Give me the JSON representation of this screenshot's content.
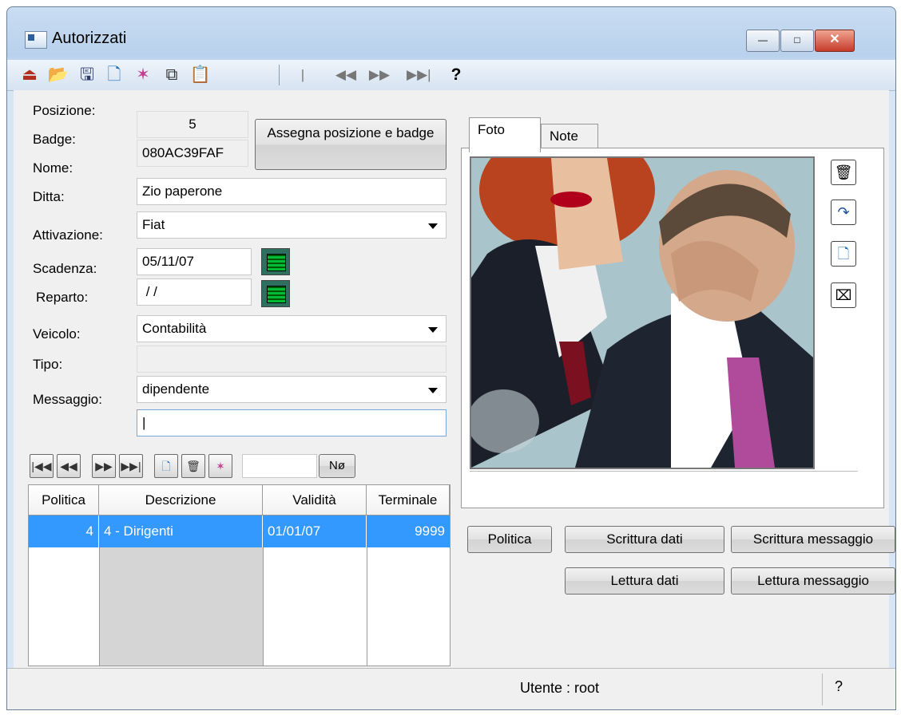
{
  "window": {
    "title": "Autorizzati",
    "min_glyph": "—",
    "max_glyph": "□",
    "close_glyph": "✕"
  },
  "toolbar": {
    "icons": [
      "exit-icon",
      "open-icon",
      "save-icon",
      "new-icon",
      "clear-icon",
      "copy-icon",
      "paste-icon",
      "first-record-icon",
      "previous-record-icon",
      "next-record-icon",
      "last-record-icon",
      "help-icon"
    ],
    "help_label": "?"
  },
  "form": {
    "posizione_label": "Posizione:",
    "posizione_value": "5",
    "badge_label": "Badge:",
    "badge_value": "080AC39FAF",
    "assign_button": "Assegna posizione e badge",
    "nome_label": "Nome:",
    "nome_value": "Zio paperone",
    "ditta_label": "Ditta:",
    "ditta_value": "Fiat",
    "attivazione_label": "Attivazione:",
    "attivazione_value": "05/11/07",
    "scadenza_label": "Scadenza:",
    "scadenza_value": " / /",
    "reparto_label": "Reparto:",
    "reparto_value": "Contabilità",
    "veicolo_label": "Veicolo:",
    "veicolo_value": "",
    "tipo_label": "Tipo:",
    "tipo_value": "dipendente",
    "messaggio_label": "Messaggio:",
    "messaggio_value": "|"
  },
  "grid_nav": {
    "search_value": "",
    "no_button": "Nø"
  },
  "grid": {
    "headers": [
      "Politica",
      "Descrizione",
      "Validità",
      "Terminale"
    ],
    "rows": [
      {
        "politica": "4",
        "descrizione": "4 - Dirigenti",
        "validita": "01/01/07",
        "terminale": "9999"
      }
    ]
  },
  "tabs": {
    "foto": "Foto",
    "note": "Note"
  },
  "buttons": {
    "politica": "Politica",
    "scrittura_dati": "Scrittura dati",
    "scrittura_messaggio": "Scrittura messaggio",
    "lettura_dati": "Lettura dati",
    "lettura_messaggio": "Lettura messaggio"
  },
  "status": {
    "user": "Utente : root",
    "help": "?"
  }
}
